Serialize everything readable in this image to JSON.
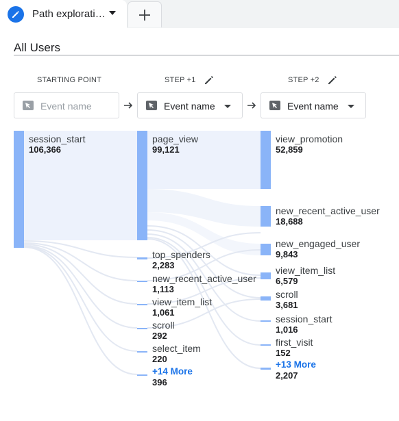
{
  "tab": {
    "title": "Path explorati…"
  },
  "segment": "All Users",
  "columns": {
    "start": {
      "header": "STARTING POINT",
      "placeholder": "Event name"
    },
    "step1": {
      "header": "STEP +1",
      "selector": "Event name"
    },
    "step2": {
      "header": "STEP +2",
      "selector": "Event name"
    }
  },
  "nodes": {
    "start": [
      {
        "name": "session_start",
        "value": "106,366"
      }
    ],
    "step1": [
      {
        "name": "page_view",
        "value": "99,121"
      },
      {
        "name": "top_spenders",
        "value": "2,283"
      },
      {
        "name": "new_recent_active_user",
        "value": "1,113"
      },
      {
        "name": "view_item_list",
        "value": "1,061"
      },
      {
        "name": "scroll",
        "value": "292"
      },
      {
        "name": "select_item",
        "value": "220"
      }
    ],
    "step1_more": {
      "label": "+14 More",
      "value": "396"
    },
    "step2": [
      {
        "name": "view_promotion",
        "value": "52,859"
      },
      {
        "name": "new_recent_active_user",
        "value": "18,688"
      },
      {
        "name": "new_engaged_user",
        "value": "9,843"
      },
      {
        "name": "view_item_list",
        "value": "6,579"
      },
      {
        "name": "scroll",
        "value": "3,681"
      },
      {
        "name": "session_start",
        "value": "1,016"
      },
      {
        "name": "first_visit",
        "value": "152"
      }
    ],
    "step2_more": {
      "label": "+13 More",
      "value": "2,207"
    }
  },
  "colors": {
    "accent": "#1a73e8",
    "node": "#8ab4f8",
    "flow": "#e8f0fe"
  }
}
